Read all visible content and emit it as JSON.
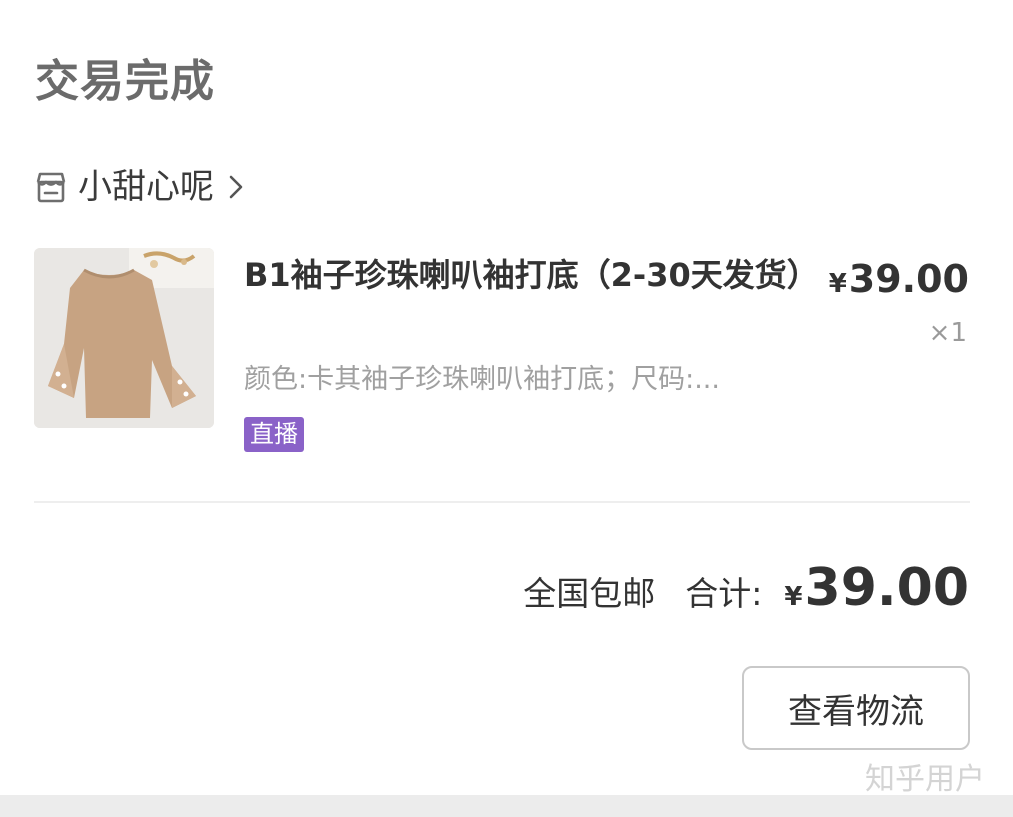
{
  "order": {
    "status": "交易完成",
    "shop": {
      "name": "小甜心呢",
      "icon": "store-icon",
      "chevron_icon": "chevron-right-icon"
    },
    "item": {
      "title": "B1袖子珍珠喇叭袖打底（2-30天发货）",
      "spec": "颜色:卡其袖子珍珠喇叭袖打底；尺码:...",
      "badge": "直播",
      "price_currency": "¥",
      "price_value": "39.00",
      "quantity": "×1",
      "image": "beige-sweater-flared-sleeves-thumbnail"
    },
    "summary": {
      "shipping": "全国包邮",
      "total_label": "合计:",
      "total_currency": "¥",
      "total_value": "39.00"
    },
    "actions": {
      "logistics_label": "查看物流"
    }
  },
  "watermark": "知乎用户",
  "colors": {
    "badge": "#8a62c8",
    "title_gray": "#6b6b6b",
    "text": "#333333",
    "muted": "#a0a0a0"
  }
}
